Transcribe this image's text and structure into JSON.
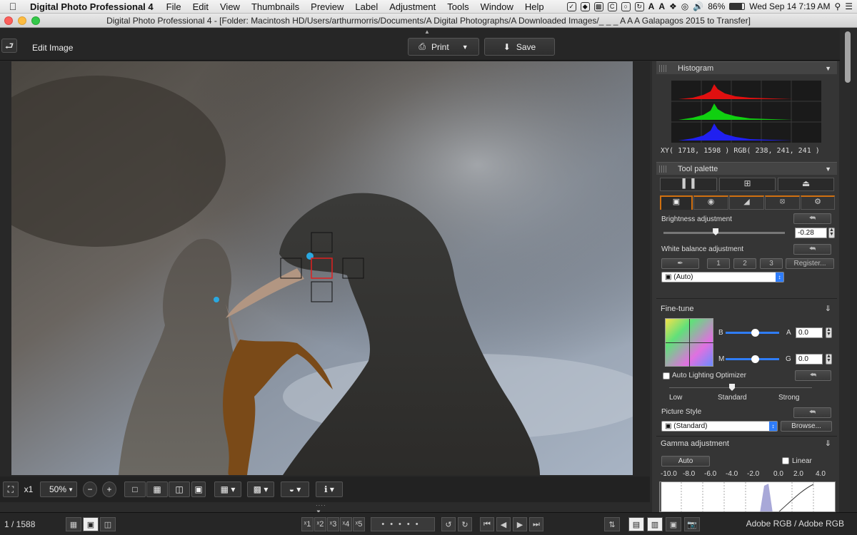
{
  "menubar": {
    "app_name": "Digital Photo Professional 4",
    "items": [
      "File",
      "Edit",
      "View",
      "Thumbnails",
      "Preview",
      "Label",
      "Adjustment",
      "Tools",
      "Window",
      "Help"
    ],
    "battery": "86%",
    "clock": "Wed Sep 14  7:19 AM"
  },
  "window": {
    "title": "Digital Photo Professional 4 - [Folder: Macintosh HD/Users/arthurmorris/Documents/A Digital Photographs/A Downloaded Images/_ _ _ A A A Galapagos 2015 to Transfer]"
  },
  "toolbar": {
    "mode_title": "Edit Image",
    "print_label": "Print",
    "save_label": "Save"
  },
  "viewer_bar": {
    "zoom_x1": "x1",
    "zoom_level": "50%"
  },
  "statusbar": {
    "image_count": "1 / 1588",
    "rating_labels": [
      "ˣ1",
      "ˣ2",
      "ˣ3",
      "ˣ4",
      "ˣ5"
    ],
    "color_profile": "Adobe RGB / Adobe RGB"
  },
  "histogram": {
    "header": "Histogram",
    "readout": "XY(  1718,  1598 ) RGB( 238,  241,  241 )"
  },
  "tool_palette": {
    "header": "Tool palette",
    "brightness_label": "Brightness adjustment",
    "brightness_value": "-0.28",
    "brightness_level": -0.28,
    "wb_label": "White balance adjustment",
    "wb_slots": [
      "1",
      "2",
      "3"
    ],
    "register_label": "Register...",
    "wb_selected": "(Auto)"
  },
  "fine_tune": {
    "header": "Fine-tune",
    "b_label": "B",
    "a_label": "A",
    "a_value": "0.0",
    "m_label": "M",
    "g_label": "G",
    "g_value": "0.0",
    "alo_label": "Auto Lighting Optimizer",
    "alo_levels": [
      "Low",
      "Standard",
      "Strong"
    ],
    "picture_style_label": "Picture Style",
    "picture_style_value": "(Standard)",
    "browse_label": "Browse..."
  },
  "gamma": {
    "header": "Gamma adjustment",
    "auto_label": "Auto",
    "linear_label": "Linear",
    "scale": [
      "-10.0",
      "-8.0",
      "-6.0",
      "-4.0",
      "-2.0",
      "0.0",
      "2.0",
      "4.0"
    ]
  },
  "colors": {
    "accent_blue": "#2f7dfa",
    "hist_red": "#e01010",
    "hist_green": "#10d010",
    "hist_blue": "#2020f0",
    "tab_active": "#d07010"
  }
}
